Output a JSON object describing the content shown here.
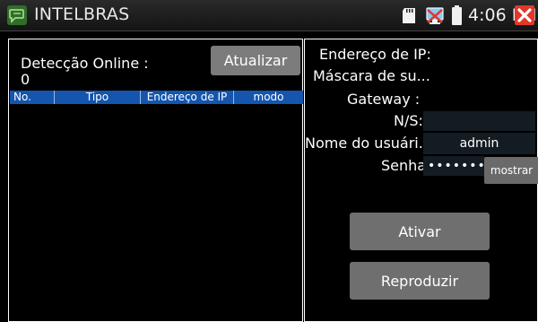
{
  "titlebar": {
    "app_icon": "chat-bubble-icon",
    "title": "INTELBRAS",
    "status_icons": [
      "sd-card-icon",
      "network-icon",
      "battery-icon"
    ],
    "clock": "4:06 PM",
    "close_icon": "close-icon"
  },
  "left_panel": {
    "detect_label": "Detecção Online :",
    "detect_count": "0",
    "update_button": "Atualizar",
    "table": {
      "columns": [
        "No.",
        "Tipo",
        "Endereço de IP",
        "modo"
      ],
      "rows": []
    }
  },
  "right_panel": {
    "ip_label": "Endereço de IP:",
    "mask_label": "Máscara de su...",
    "gateway_label": "Gateway :",
    "ns_label": "N/S:",
    "ns_value": "",
    "username_label": "Nome do usuári...",
    "username_value": "admin",
    "password_label": "Senha:",
    "password_value": "•••••••",
    "show_button": "mostrar",
    "activate_button": "Ativar",
    "play_button": "Reproduzir"
  },
  "colors": {
    "header_bg": "#1555ad",
    "button_bg": "#7c7c7c",
    "close_bg": "#e0392b",
    "field_bg": "#141c23"
  }
}
